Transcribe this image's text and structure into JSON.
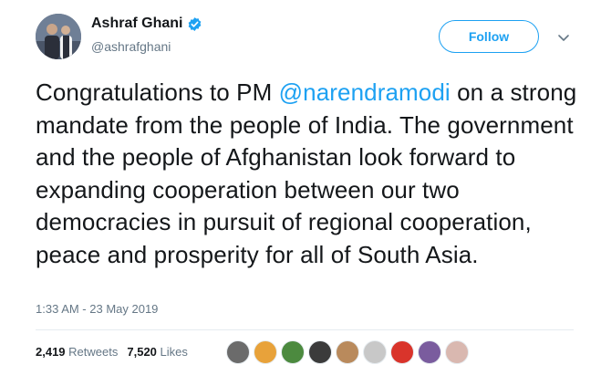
{
  "author": {
    "display_name": "Ashraf Ghani",
    "handle": "@ashrafghani",
    "verified": true,
    "avatar_icon": "profile-photo"
  },
  "follow_button": {
    "label": "Follow"
  },
  "menu": {
    "icon": "chevron-down-icon"
  },
  "tweet": {
    "text_before": "Congratulations to PM ",
    "mention": "@narendramodi",
    "text_after": " on a strong mandate from the people of India. The government and the people of Afghanistan look forward to expanding cooperation between our two democracies in pursuit of regional cooperation, peace and prosperity for all of South Asia."
  },
  "timestamp": "1:33 AM - 23 May 2019",
  "stats": {
    "retweets_count": "2,419",
    "retweets_label": "Retweets",
    "likes_count": "7,520",
    "likes_label": "Likes"
  },
  "likers": [
    {
      "color": "#6b6b6b"
    },
    {
      "color": "#e8a23a"
    },
    {
      "color": "#4c8a3f"
    },
    {
      "color": "#3b3b3b"
    },
    {
      "color": "#b98a5c"
    },
    {
      "color": "#c8c8c8"
    },
    {
      "color": "#d9342b"
    },
    {
      "color": "#7a5c9e"
    },
    {
      "color": "#d9b8b0"
    }
  ],
  "colors": {
    "accent": "#1da1f2",
    "text": "#14171a",
    "muted": "#657786"
  }
}
